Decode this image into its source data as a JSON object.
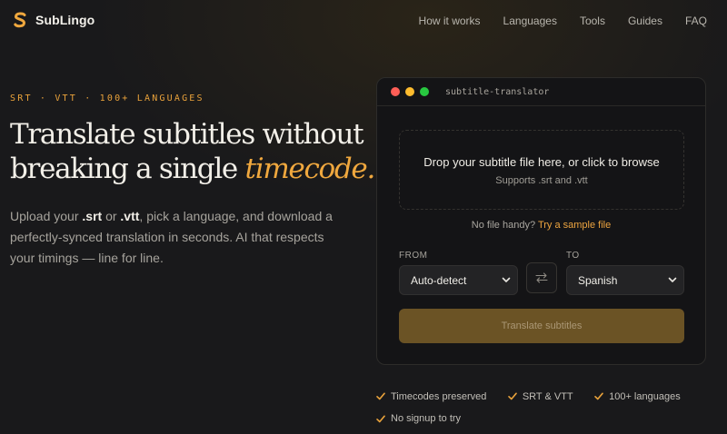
{
  "brand": {
    "name": "SubLingo",
    "accent": "#f0a83e"
  },
  "nav": {
    "items": [
      {
        "label": "How it works"
      },
      {
        "label": "Languages"
      },
      {
        "label": "Tools"
      },
      {
        "label": "Guides"
      },
      {
        "label": "FAQ"
      }
    ]
  },
  "hero": {
    "eyebrow": "SRT · VTT · 100+ LANGUAGES",
    "headline_line1": "Translate subtitles without",
    "headline_line2_plain": "breaking a single ",
    "headline_line2_accent": "timecode.",
    "lede_part1": "Upload your ",
    "lede_srt": ".srt",
    "lede_part2": " or ",
    "lede_vtt": ".vtt",
    "lede_part3": ", pick a language, and download a perfectly-synced translation in seconds. AI that respects your timings — line for line."
  },
  "translator": {
    "window_title": "subtitle-translator",
    "dropzone_title": "Drop your subtitle file here, or click to browse",
    "dropzone_subtitle": "Supports .srt and .vtt",
    "sample_prompt": "No file handy?",
    "sample_link": "Try a sample file",
    "from_label": "FROM",
    "from_value": "Auto-detect",
    "to_label": "TO",
    "to_value": "Spanish",
    "swap_icon": "swap-arrows-icon",
    "submit_label": "Translate subtitles"
  },
  "features": [
    {
      "label": "Timecodes preserved"
    },
    {
      "label": "SRT & VTT"
    },
    {
      "label": "100+ languages"
    },
    {
      "label": "No signup to try"
    }
  ],
  "colors": {
    "background": "#19191b",
    "panel": "#141416",
    "button_disabled": "#6b5325",
    "mac_red": "#ff5f57",
    "mac_yellow": "#febc2e",
    "mac_green": "#28c840"
  }
}
